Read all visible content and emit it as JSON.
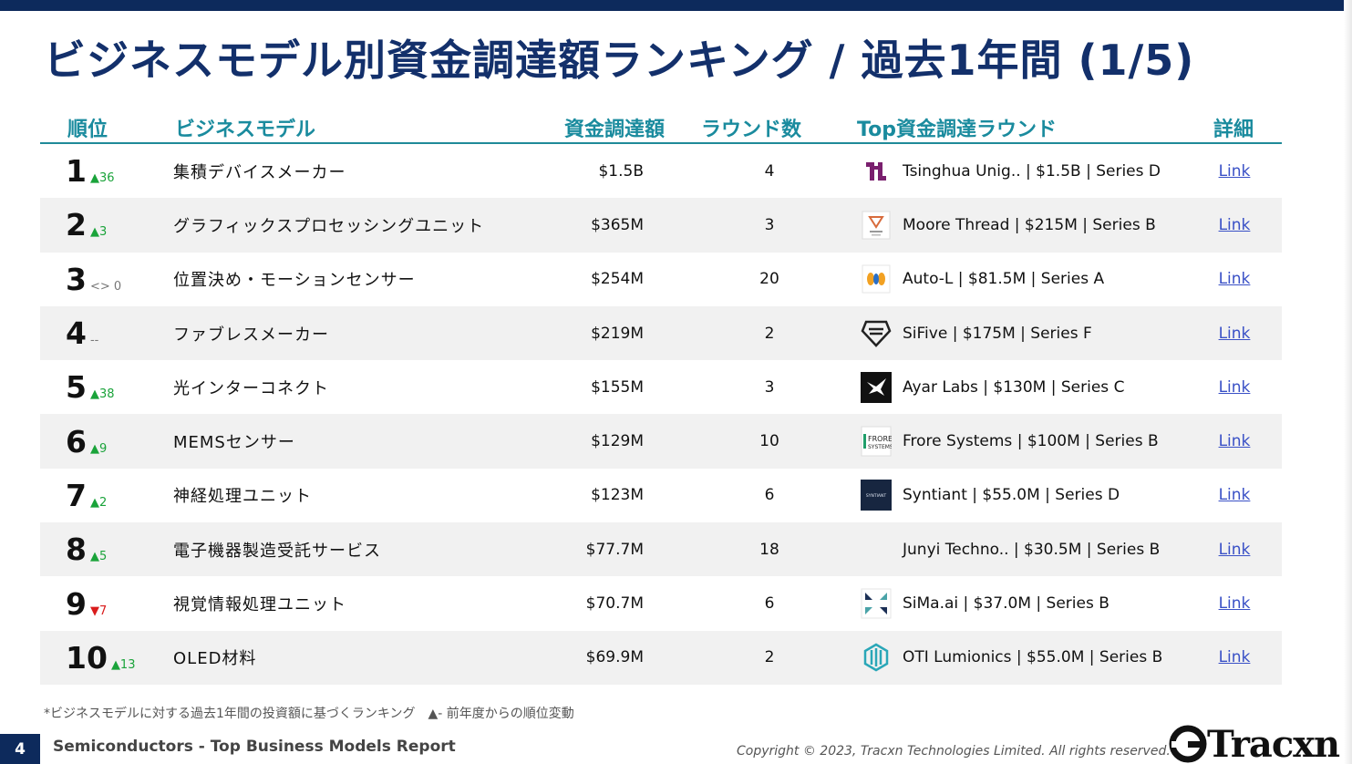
{
  "page": {
    "title": "ビジネスモデル別資金調達額ランキング / 過去1年間 (1/5)",
    "footnote": "*ビジネスモデルに対する過去1年間の投資額に基づくランキング　▲- 前年度からの順位変動",
    "page_number": "4",
    "report_name": "Semiconductors - Top Business Models Report",
    "copyright": "Copyright © 2023, Tracxn Technologies Limited. All rights reserved.",
    "brand": "Tracxn"
  },
  "colors": {
    "title": "#13306b",
    "header": "#1a8b9e",
    "up": "#1aa33a",
    "down": "#d91c1c",
    "link": "#3950c6",
    "navy": "#0d2a5c"
  },
  "table": {
    "headers": {
      "rank": "順位",
      "model": "ビジネスモデル",
      "amount": "資金調達額",
      "rounds": "ラウンド数",
      "top_round": "Top資金調達ラウンド",
      "detail": "詳細"
    },
    "rows": [
      {
        "rank": "1",
        "change": "▲36",
        "dir": "up",
        "model": "集積デバイスメーカー",
        "amount": "$1.5B",
        "rounds": "4",
        "logo": "tsinghua-logo-icon",
        "top_round": "Tsinghua Unig.. | $1.5B | Series D",
        "link": "Link"
      },
      {
        "rank": "2",
        "change": "▲3",
        "dir": "up",
        "model": "グラフィックスプロセッシングユニット",
        "amount": "$365M",
        "rounds": "3",
        "logo": "moore-thread-logo-icon",
        "top_round": "Moore Thread | $215M | Series B",
        "link": "Link"
      },
      {
        "rank": "3",
        "change": "<> 0",
        "dir": "flat",
        "model": "位置決め・モーションセンサー",
        "amount": "$254M",
        "rounds": "20",
        "logo": "auto-l-logo-icon",
        "top_round": "Auto-L | $81.5M | Series A",
        "link": "Link"
      },
      {
        "rank": "4",
        "change": "--",
        "dir": "flat",
        "model": "ファブレスメーカー",
        "amount": "$219M",
        "rounds": "2",
        "logo": "sifive-logo-icon",
        "top_round": "SiFive | $175M | Series F",
        "link": "Link"
      },
      {
        "rank": "5",
        "change": "▲38",
        "dir": "up",
        "model": "光インターコネクト",
        "amount": "$155M",
        "rounds": "3",
        "logo": "ayar-labs-logo-icon",
        "top_round": "Ayar Labs | $130M | Series C",
        "link": "Link"
      },
      {
        "rank": "6",
        "change": "▲9",
        "dir": "up",
        "model": "MEMSセンサー",
        "amount": "$129M",
        "rounds": "10",
        "logo": "frore-systems-logo-icon",
        "top_round": "Frore Systems | $100M | Series B",
        "link": "Link"
      },
      {
        "rank": "7",
        "change": "▲2",
        "dir": "up",
        "model": "神経処理ユニット",
        "amount": "$123M",
        "rounds": "6",
        "logo": "syntiant-logo-icon",
        "top_round": "Syntiant | $55.0M | Series D",
        "link": "Link"
      },
      {
        "rank": "8",
        "change": "▲5",
        "dir": "up",
        "model": "電子機器製造受託サービス",
        "amount": "$77.7M",
        "rounds": "18",
        "logo": "",
        "top_round": "Junyi Techno.. | $30.5M | Series B",
        "link": "Link"
      },
      {
        "rank": "9",
        "change": "▼7",
        "dir": "down",
        "model": "視覚情報処理ユニット",
        "amount": "$70.7M",
        "rounds": "6",
        "logo": "sima-ai-logo-icon",
        "top_round": "SiMa.ai | $37.0M | Series B",
        "link": "Link"
      },
      {
        "rank": "10",
        "change": "▲13",
        "dir": "up",
        "model": "OLED材料",
        "amount": "$69.9M",
        "rounds": "2",
        "logo": "oti-lumionics-logo-icon",
        "top_round": "OTI Lumionics | $55.0M | Series B",
        "link": "Link"
      }
    ]
  }
}
